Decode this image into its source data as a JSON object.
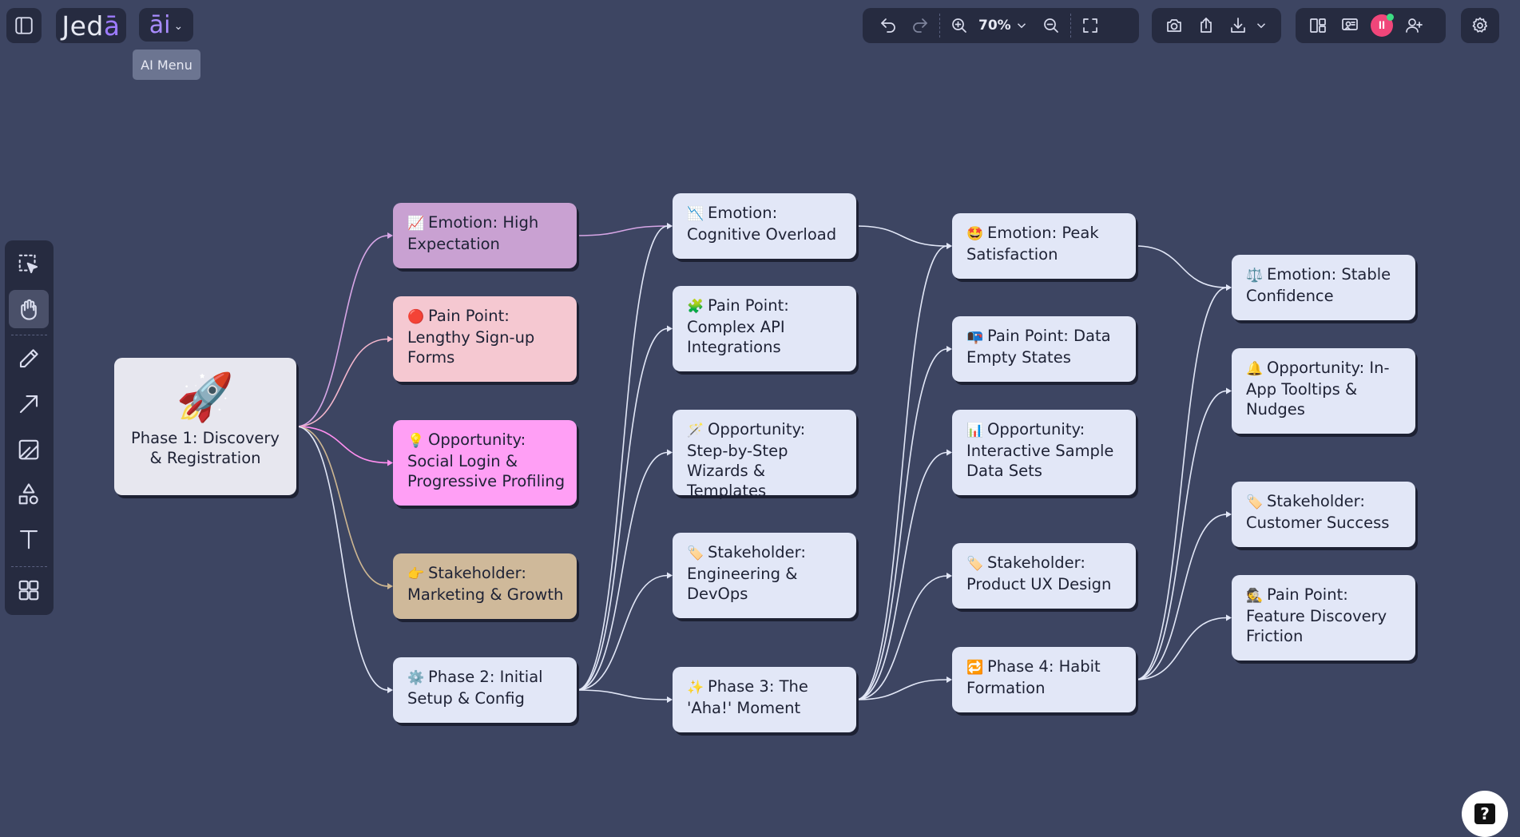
{
  "app": {
    "logo_prefix": "Jed",
    "logo_accent": "ā",
    "ai_button_label": "āi",
    "ai_tooltip": "AI Menu"
  },
  "toolbar": {
    "zoom_level": "70%"
  },
  "left_toolbar": {
    "tools": [
      "select-area",
      "hand",
      "pencil",
      "arrow",
      "frame",
      "shapes",
      "text",
      "grid"
    ],
    "active_tool": "hand"
  },
  "nodes": [
    {
      "id": "root",
      "emoji": "🚀",
      "label": "Phase 1: Discovery & Registration",
      "color": "#e7e7ef"
    },
    {
      "id": "c1_emotion",
      "emoji": "📈",
      "label": "Emotion: High Expectation",
      "color": "#c9a1d2"
    },
    {
      "id": "c1_pain",
      "emoji": "🔴",
      "label": "Pain Point: Lengthy Sign-up Forms",
      "color": "#f5c8d1"
    },
    {
      "id": "c1_opp",
      "emoji": "💡",
      "label": "Opportunity: Social Login & Progressive Profiling",
      "color": "#ff9ff5"
    },
    {
      "id": "c1_stake",
      "emoji": "👉",
      "label": "Stakeholder: Marketing & Growth",
      "color": "#cfb99a"
    },
    {
      "id": "c1_phase2",
      "emoji": "⚙️",
      "label": "Phase 2: Initial Setup & Config",
      "color": "#e2e7f7"
    },
    {
      "id": "c2_emotion",
      "emoji": "📉",
      "label": "Emotion: Cognitive Overload",
      "color": "#e2e7f7"
    },
    {
      "id": "c2_pain",
      "emoji": "🧩",
      "label": "Pain Point: Complex API Integrations",
      "color": "#e2e7f7"
    },
    {
      "id": "c2_opp",
      "emoji": "🪄",
      "label": "Opportunity: Step-by-Step Wizards & Templates",
      "color": "#e2e7f7"
    },
    {
      "id": "c2_stake",
      "emoji": "🏷️",
      "label": "Stakeholder: Engineering & DevOps",
      "color": "#e2e7f7"
    },
    {
      "id": "c2_phase3",
      "emoji": "✨",
      "label": "Phase 3: The 'Aha!' Moment",
      "color": "#e2e7f7"
    },
    {
      "id": "c3_emotion",
      "emoji": "🤩",
      "label": "Emotion: Peak Satisfaction",
      "color": "#e2e7f7"
    },
    {
      "id": "c3_pain",
      "emoji": "📭",
      "label": "Pain Point: Data Empty States",
      "color": "#e2e7f7"
    },
    {
      "id": "c3_opp",
      "emoji": "📊",
      "label": "Opportunity: Interactive Sample Data Sets",
      "color": "#e2e7f7"
    },
    {
      "id": "c3_stake",
      "emoji": "🏷️",
      "label": "Stakeholder: Product UX Design",
      "color": "#e2e7f7"
    },
    {
      "id": "c3_phase4",
      "emoji": "🔁",
      "label": "Phase 4: Habit Formation",
      "color": "#e2e7f7"
    },
    {
      "id": "c4_emotion",
      "emoji": "⚖️",
      "label": "Emotion: Stable Confidence",
      "color": "#e2e7f7"
    },
    {
      "id": "c4_opp",
      "emoji": "🔔",
      "label": "Opportunity: In-App Tooltips & Nudges",
      "color": "#e2e7f7"
    },
    {
      "id": "c4_stake",
      "emoji": "🏷️",
      "label": "Stakeholder: Customer Success",
      "color": "#e2e7f7"
    },
    {
      "id": "c4_pain",
      "emoji": "🕵️",
      "label": "Pain Point: Feature Discovery Friction",
      "color": "#e2e7f7"
    }
  ],
  "edges": [
    {
      "from": "root",
      "to": "c1_emotion",
      "color": "#d7a6e6"
    },
    {
      "from": "root",
      "to": "c1_pain",
      "color": "#f3b6cc"
    },
    {
      "from": "root",
      "to": "c1_opp",
      "color": "#ff8ff0"
    },
    {
      "from": "root",
      "to": "c1_stake",
      "color": "#cdb691"
    },
    {
      "from": "root",
      "to": "c1_phase2",
      "color": "#e2e7f7"
    },
    {
      "from": "c1_emotion",
      "to": "c2_emotion",
      "color": "#d7a6e6"
    },
    {
      "from": "c1_phase2",
      "to": "c2_emotion",
      "color": "#e2e7f7"
    },
    {
      "from": "c1_phase2",
      "to": "c2_pain",
      "color": "#e2e7f7"
    },
    {
      "from": "c1_phase2",
      "to": "c2_opp",
      "color": "#e2e7f7"
    },
    {
      "from": "c1_phase2",
      "to": "c2_stake",
      "color": "#e2e7f7"
    },
    {
      "from": "c1_phase2",
      "to": "c2_phase3",
      "color": "#e2e7f7"
    },
    {
      "from": "c2_emotion",
      "to": "c3_emotion",
      "color": "#e2e7f7"
    },
    {
      "from": "c2_phase3",
      "to": "c3_emotion",
      "color": "#e2e7f7"
    },
    {
      "from": "c2_phase3",
      "to": "c3_pain",
      "color": "#e2e7f7"
    },
    {
      "from": "c2_phase3",
      "to": "c3_opp",
      "color": "#e2e7f7"
    },
    {
      "from": "c2_phase3",
      "to": "c3_stake",
      "color": "#e2e7f7"
    },
    {
      "from": "c2_phase3",
      "to": "c3_phase4",
      "color": "#e2e7f7"
    },
    {
      "from": "c3_emotion",
      "to": "c4_emotion",
      "color": "#e2e7f7"
    },
    {
      "from": "c3_phase4",
      "to": "c4_emotion",
      "color": "#e2e7f7"
    },
    {
      "from": "c3_phase4",
      "to": "c4_opp",
      "color": "#e2e7f7"
    },
    {
      "from": "c3_phase4",
      "to": "c4_stake",
      "color": "#e2e7f7"
    },
    {
      "from": "c3_phase4",
      "to": "c4_pain",
      "color": "#e2e7f7"
    }
  ],
  "colors": {
    "canvas_background": "#3d4562",
    "toolbar_background": "#262b40",
    "brand_accent": "#9d7bff",
    "avatar": "#f0467a",
    "online_dot": "#3ddc84"
  }
}
